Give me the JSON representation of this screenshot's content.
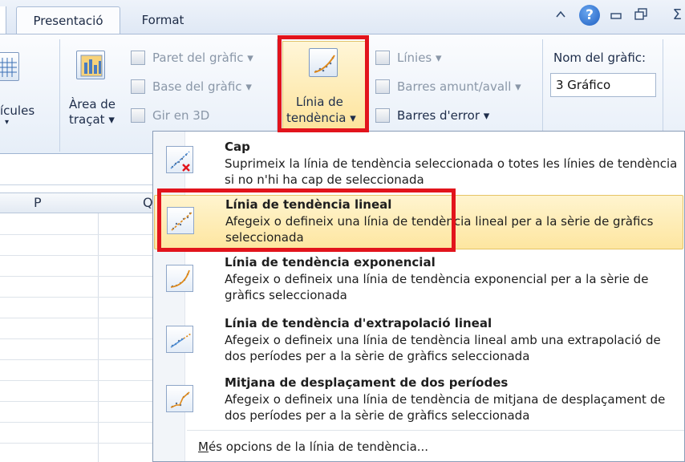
{
  "tabs": [
    {
      "label": "Presentació",
      "active": true
    },
    {
      "label": "Format",
      "active": false
    }
  ],
  "window_controls": {
    "minimize_ribbon_icon": "chevron-up-icon",
    "help_label": "?",
    "minimize_icon": "minimize-icon",
    "restore_icon": "restore-icon",
    "close_label": "Σ"
  },
  "ribbon": {
    "gridlines_label": "ícules",
    "plot_area": {
      "line1": "Àrea de",
      "line2": "traçat ▾"
    },
    "chart_wall": "Paret del gràfic ▾",
    "chart_floor": "Base del gràfic ▾",
    "rotate_3d": "Gir en 3D",
    "trendline": {
      "line1": "Línia de",
      "line2": "tendència ▾"
    },
    "lines": "Línies ▾",
    "updown_bars": "Barres amunt/avall ▾",
    "error_bars": "Barres d'error ▾",
    "chart_name_label": "Nom del gràfic:",
    "chart_name_value": "3 Gráfico"
  },
  "columns": [
    "P",
    "Q"
  ],
  "menu": {
    "items": [
      {
        "title": "Cap",
        "desc": "Suprimeix la línia de tendència seleccionada o totes les línies de tendència si no n'hi ha cap de seleccionada",
        "icon": "no-trendline-icon"
      },
      {
        "title": "Línia de tendència lineal",
        "desc": "Afegeix o defineix una línia de tendència lineal per a la sèrie de gràfics seleccionada",
        "icon": "linear-trendline-icon"
      },
      {
        "title": "Línia de tendència exponencial",
        "desc": "Afegeix o defineix una línia de tendència exponencial per a la sèrie de gràfics seleccionada",
        "icon": "exponential-trendline-icon"
      },
      {
        "title": "Línia de tendència d'extrapolació lineal",
        "desc": "Afegeix o defineix una línia de tendència lineal amb una extrapolació de dos períodes per a la sèrie de gràfics seleccionada",
        "icon": "forecast-trendline-icon"
      },
      {
        "title": "Mitjana de desplaçament de dos períodes",
        "desc": "Afegeix o defineix una línia de tendència de mitjana de desplaçament de dos períodes per a la sèrie de gràfics seleccionada",
        "icon": "moving-average-icon"
      }
    ],
    "more_options_accel": "M",
    "more_options_rest": "és opcions de la línia de tendència..."
  },
  "colors": {
    "highlight_border": "#e2141c",
    "hover_bg": "#fde6a0"
  }
}
